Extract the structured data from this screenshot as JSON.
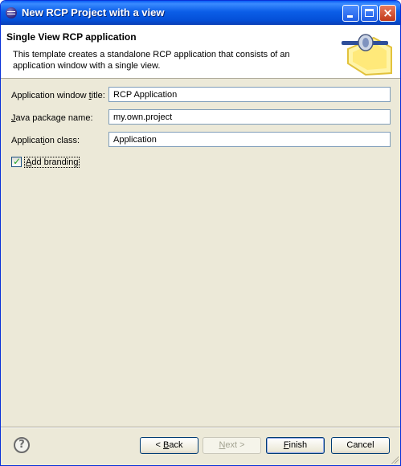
{
  "window": {
    "title": "New RCP Project with a view",
    "close_glyph": "×"
  },
  "header": {
    "title": "Single View RCP application",
    "description": "This template creates a standalone RCP application that consists of an application window with a single view.",
    "art_icon": "wizard-plugin-icon"
  },
  "form": {
    "window_title": {
      "label_pre": "Application window ",
      "label_key": "t",
      "label_post": "itle:",
      "value": "RCP Application"
    },
    "package": {
      "label_key": "J",
      "label_post": "ava package name:",
      "value": "my.own.project"
    },
    "app_class": {
      "label_pre": "Applicat",
      "label_key": "i",
      "label_post": "on class:",
      "value": "Application"
    },
    "branding": {
      "label_key": "A",
      "label_post": "dd branding",
      "checked": true,
      "check_glyph": "✓"
    }
  },
  "footer": {
    "help_glyph": "?",
    "back": {
      "pre": "< ",
      "key": "B",
      "post": "ack"
    },
    "next": {
      "key": "N",
      "post": "ext >"
    },
    "finish": {
      "key": "F",
      "post": "inish"
    },
    "cancel": "Cancel"
  },
  "colors": {
    "title_bar": "#0a5df5",
    "dialog_bg": "#ece9d8",
    "header_bg": "#ffffff"
  }
}
